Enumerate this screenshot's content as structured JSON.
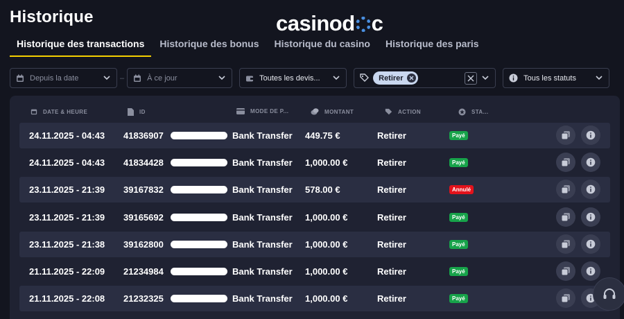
{
  "page": {
    "title": "Historique"
  },
  "logo": {
    "part1": "casino",
    "part2": "d",
    "part3": "c"
  },
  "tabs": [
    {
      "label": "Historique des transactions",
      "active": true
    },
    {
      "label": "Historique des bonus"
    },
    {
      "label": "Historique du casino"
    },
    {
      "label": "Historique des paris"
    }
  ],
  "filters": {
    "date_from": {
      "placeholder": "Depuis la date"
    },
    "separator": "–",
    "date_to": {
      "placeholder": "À ce jour"
    },
    "currency": {
      "value": "Toutes les devis..."
    },
    "action": {
      "chip": "Retirer"
    },
    "status": {
      "value": "Tous les statuts"
    }
  },
  "table": {
    "headers": [
      "DATE & HEURE",
      "ID",
      "MODE DE P...",
      "MONTANT",
      "ACTION",
      "STA..."
    ],
    "rows": [
      {
        "date": "24.11.2025 - 04:43",
        "id": "41836907",
        "method": "Bank Transfer",
        "amount": "449.75 €",
        "action": "Retirer",
        "status": "Payé",
        "status_type": "paid"
      },
      {
        "date": "24.11.2025 - 04:43",
        "id": "41834428",
        "method": "Bank Transfer",
        "amount": "1,000.00 €",
        "action": "Retirer",
        "status": "Payé",
        "status_type": "paid"
      },
      {
        "date": "23.11.2025 - 21:39",
        "id": "39167832",
        "method": "Bank Transfer",
        "amount": "578.00 €",
        "action": "Retirer",
        "status": "Annulé",
        "status_type": "cancel"
      },
      {
        "date": "23.11.2025 - 21:39",
        "id": "39165692",
        "method": "Bank Transfer",
        "amount": "1,000.00 €",
        "action": "Retirer",
        "status": "Payé",
        "status_type": "paid"
      },
      {
        "date": "23.11.2025 - 21:38",
        "id": "39162800",
        "method": "Bank Transfer",
        "amount": "1,000.00 €",
        "action": "Retirer",
        "status": "Payé",
        "status_type": "paid"
      },
      {
        "date": "21.11.2025 - 22:09",
        "id": "21234984",
        "method": "Bank Transfer",
        "amount": "1,000.00 €",
        "action": "Retirer",
        "status": "Payé",
        "status_type": "paid"
      },
      {
        "date": "21.11.2025 - 22:08",
        "id": "21232325",
        "method": "Bank Transfer",
        "amount": "1,000.00 €",
        "action": "Retirer",
        "status": "Payé",
        "status_type": "paid"
      }
    ]
  },
  "icons": {
    "calendar": "calendar-icon",
    "currency": "wallet-icon",
    "action": "tag-icon",
    "status": "info-icon",
    "copy": "copy-icon",
    "info": "info-icon",
    "support": "headset-icon"
  },
  "colors": {
    "background": "#13151f",
    "panel": "#1f2232",
    "row_shaded": "#2a2e42",
    "accent": "#f5d000",
    "paid": "#17a34a",
    "cancel": "#e3121b"
  }
}
